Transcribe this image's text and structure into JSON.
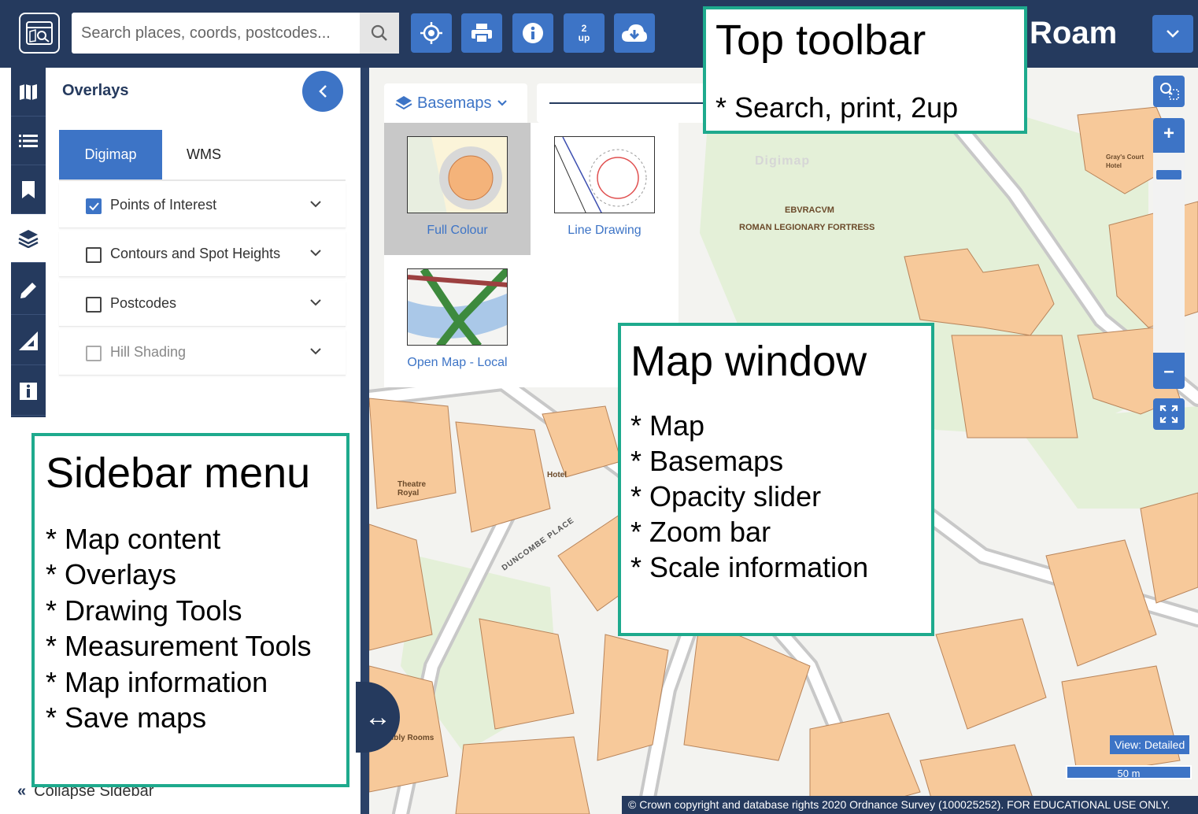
{
  "toolbar": {
    "app_icon": "map-search-icon",
    "search": {
      "placeholder": "Search places, coords, postcodes..."
    },
    "buttons": [
      {
        "name": "locate",
        "icon": "crosshair-icon"
      },
      {
        "name": "print",
        "icon": "printer-icon"
      },
      {
        "name": "info",
        "icon": "info-icon"
      },
      {
        "name": "2up",
        "label_top": "2",
        "label_bottom": "up"
      },
      {
        "name": "download",
        "icon": "cloud-download-icon"
      }
    ],
    "brand": "Roam",
    "menu_icon": "chevron-down-icon"
  },
  "rail": {
    "items": [
      {
        "icon": "map-icon"
      },
      {
        "icon": "list-icon"
      },
      {
        "icon": "bookmark-icon"
      },
      {
        "icon": "layers-icon",
        "active": true
      },
      {
        "icon": "pencil-icon"
      },
      {
        "icon": "ruler-triangle-icon"
      },
      {
        "icon": "info-box-icon"
      }
    ]
  },
  "sidebar": {
    "title": "Overlays",
    "tabs": [
      {
        "label": "Digimap",
        "active": true
      },
      {
        "label": "WMS",
        "active": false
      }
    ],
    "overlays": [
      {
        "label": "Points of Interest",
        "checked": true
      },
      {
        "label": "Contours and Spot Heights",
        "checked": false
      },
      {
        "label": "Postcodes",
        "checked": false
      },
      {
        "label": "Hill Shading",
        "checked": false,
        "disabled": true
      }
    ],
    "collapse_label": "Collapse Sidebar"
  },
  "map": {
    "basemaps": {
      "button_label": "Basemaps",
      "options": [
        {
          "label": "Full Colour",
          "selected": true
        },
        {
          "label": "Line Drawing",
          "selected": false
        },
        {
          "label": "Open Map - Local",
          "selected": false
        }
      ]
    },
    "labels": {
      "ebvracvm": "EBVRACVM",
      "roman": "ROMAN LEGIONARY FORTRESS",
      "theatre": "Theatre Royal",
      "hotel": "Hotel",
      "duncombe": "DUNCOMBE PLACE",
      "greys": "Gray's Court Hotel",
      "watermark": "Digimap",
      "assembly": "...mbly Rooms"
    },
    "view_badge": "View: Detailed",
    "scale": "50 m",
    "copyright": "© Crown copyright and database rights 2020 Ordnance Survey (100025252). FOR EDUCATIONAL USE ONLY."
  },
  "callouts": {
    "toolbar": {
      "title": "Top toolbar",
      "items": [
        "* Search, print, 2up"
      ]
    },
    "map": {
      "title": "Map window",
      "items": [
        "* Map",
        "* Basemaps",
        "* Opacity slider",
        "* Zoom bar",
        "* Scale information"
      ]
    },
    "sidebar": {
      "title": "Sidebar menu",
      "items": [
        "* Map content",
        "* Overlays",
        "* Drawing Tools",
        "* Measurement Tools",
        "* Map information",
        "* Save maps"
      ]
    }
  },
  "colors": {
    "navy": "#253a5e",
    "accent": "#3d74c6",
    "callout_border": "#1eaa8d",
    "building": "#f7c99a"
  }
}
